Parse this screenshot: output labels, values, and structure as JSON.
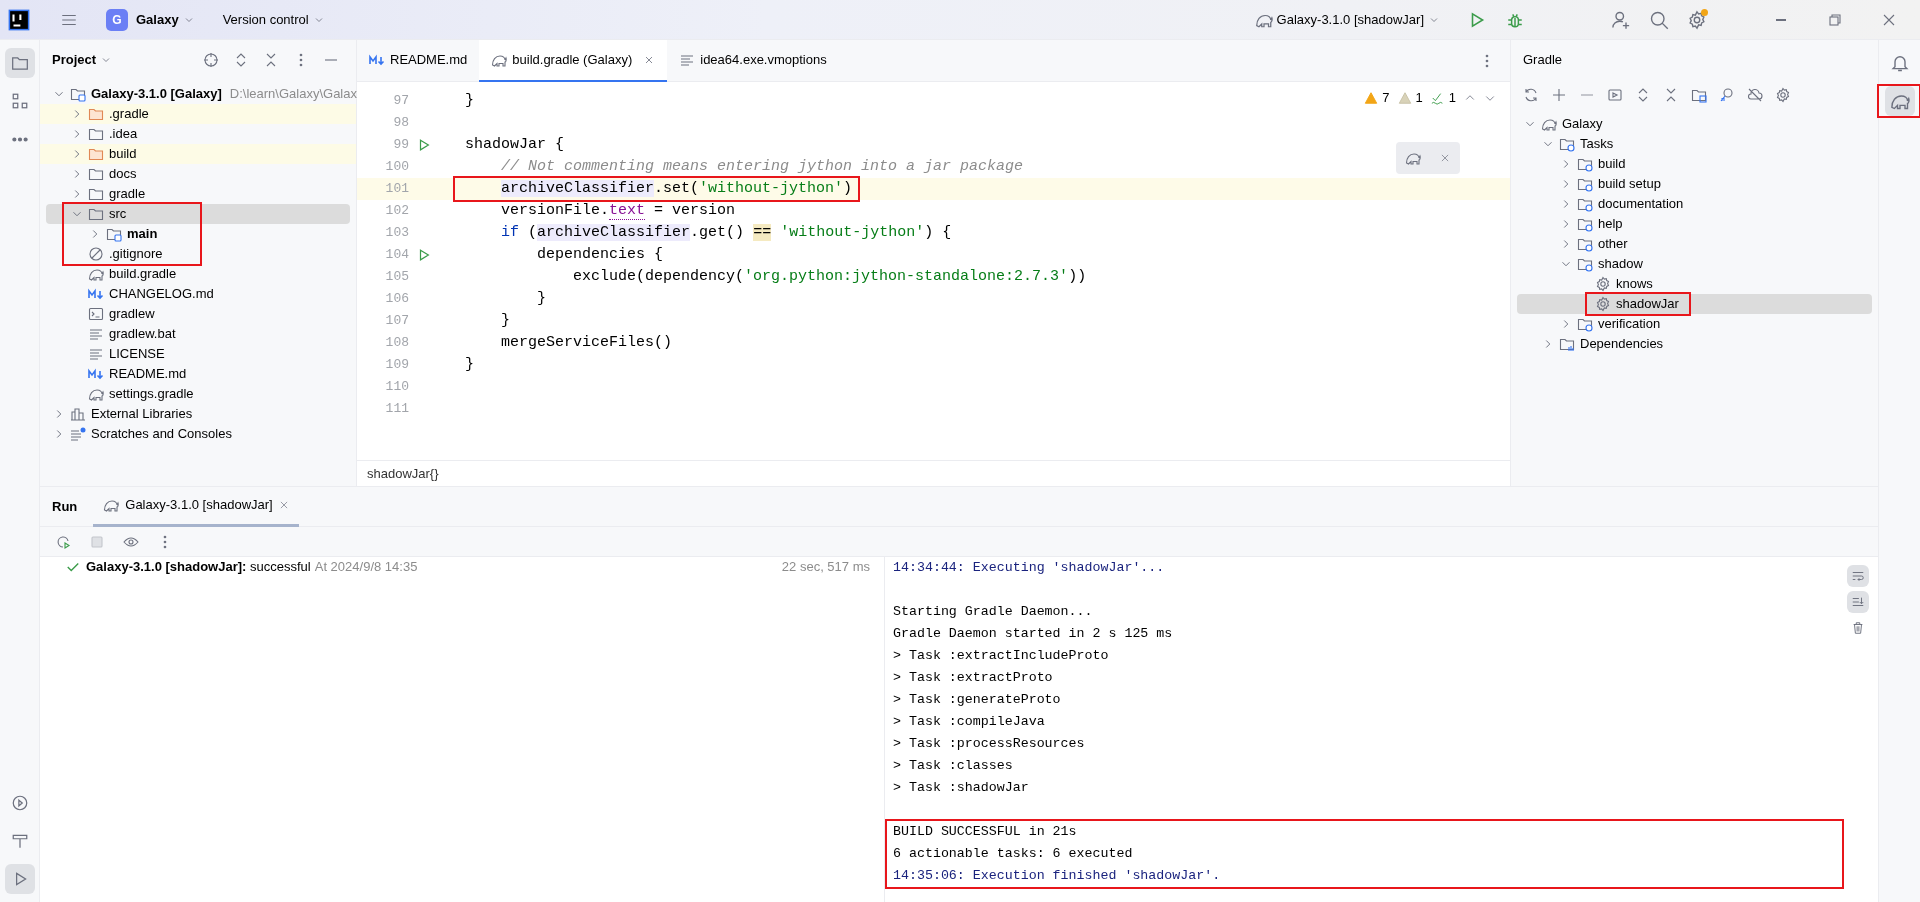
{
  "title_bar": {
    "project_initial": "G",
    "project": "Galaxy",
    "vcs": "Version control",
    "run_config": "Galaxy-3.1.0 [shadowJar]",
    "settings_badge": true
  },
  "left_tools": [
    {
      "kind": "folder",
      "selected": true
    },
    {
      "kind": "structure",
      "selected": false
    },
    {
      "kind": "more",
      "selected": false
    }
  ],
  "left_tools_bottom": [
    {
      "kind": "services",
      "selected": false
    },
    {
      "kind": "build",
      "selected": false
    },
    {
      "kind": "run",
      "selected": true
    }
  ],
  "project_panel": {
    "title": "Project",
    "tree": [
      {
        "label": "Galaxy-3.1.0 [Galaxy]",
        "path": "D:\\learn\\Galaxy\\Galax",
        "kind": "module",
        "expanded": true,
        "selected": false,
        "children": [
          {
            "label": ".gradle",
            "kind": "excluded-folder",
            "expanded": false,
            "selected": false
          },
          {
            "label": ".idea",
            "kind": "folder",
            "expanded": false,
            "selected": false
          },
          {
            "label": "build",
            "kind": "excluded-folder",
            "expanded": false,
            "selected": false
          },
          {
            "label": "docs",
            "kind": "folder",
            "expanded": false,
            "selected": false
          },
          {
            "label": "gradle",
            "kind": "folder",
            "expanded": false,
            "selected": false
          },
          {
            "label": "src",
            "kind": "folder",
            "expanded": true,
            "selected": true,
            "annotated": true,
            "children": [
              {
                "label": "main",
                "kind": "source-root",
                "expanded": false,
                "selected": false,
                "annotated": true
              }
            ]
          },
          {
            "label": ".gitignore",
            "kind": "ignore",
            "selected": false,
            "annotated": true
          },
          {
            "label": "build.gradle",
            "kind": "gradle",
            "selected": false
          },
          {
            "label": "CHANGELOG.md",
            "kind": "markdown",
            "selected": false
          },
          {
            "label": "gradlew",
            "kind": "script",
            "selected": false
          },
          {
            "label": "gradlew.bat",
            "kind": "text",
            "selected": false
          },
          {
            "label": "LICENSE",
            "kind": "text",
            "selected": false
          },
          {
            "label": "README.md",
            "kind": "markdown",
            "selected": false
          },
          {
            "label": "settings.gradle",
            "kind": "gradle",
            "selected": false
          }
        ]
      },
      {
        "label": "External Libraries",
        "kind": "libraries",
        "expanded": false,
        "selected": false
      },
      {
        "label": "Scratches and Consoles",
        "kind": "scratches",
        "expanded": false,
        "selected": false
      }
    ]
  },
  "editor": {
    "tabs": [
      {
        "label": "README.md",
        "kind": "markdown",
        "selected": false
      },
      {
        "label": "build.gradle (Galaxy)",
        "kind": "gradle",
        "selected": true
      },
      {
        "label": "idea64.exe.vmoptions",
        "kind": "text",
        "selected": false
      }
    ],
    "inspections": [
      {
        "kind": "warning",
        "count": "7"
      },
      {
        "kind": "weak-warning",
        "count": "1"
      },
      {
        "kind": "typo",
        "count": "1"
      }
    ],
    "lines": [
      {
        "number": "97",
        "tokens": [
          {
            "kind": "plain",
            "text": "}"
          }
        ]
      },
      {
        "number": "98"
      },
      {
        "number": "99",
        "runnable": true,
        "tokens": [
          {
            "kind": "plain",
            "text": "shadowJar {"
          }
        ]
      },
      {
        "number": "100",
        "tokens": [
          {
            "kind": "comment",
            "text": "    // Not commenting means entering jython into a jar package"
          }
        ]
      },
      {
        "number": "101",
        "current": true,
        "annotated": true,
        "tokens": [
          {
            "kind": "reference",
            "text": "    archiveClassifier"
          },
          {
            "kind": "plain",
            "text": ".set("
          },
          {
            "kind": "string",
            "text": "'without-jython'"
          },
          {
            "kind": "plain",
            "text": ")"
          }
        ]
      },
      {
        "number": "102",
        "tokens": [
          {
            "kind": "plain",
            "text": "    versionFile."
          },
          {
            "kind": "field",
            "text": "text"
          },
          {
            "kind": "plain",
            "text": " = version"
          }
        ]
      },
      {
        "number": "103",
        "tokens": [
          {
            "kind": "keyword",
            "text": "    if"
          },
          {
            "kind": "plain",
            "text": " ("
          },
          {
            "kind": "reference",
            "text": "archiveClassifier"
          },
          {
            "kind": "plain",
            "text": ".get() "
          },
          {
            "kind": "operator",
            "text": "== "
          },
          {
            "kind": "string",
            "text": "'without-jython'"
          },
          {
            "kind": "plain",
            "text": ") {"
          }
        ]
      },
      {
        "number": "104",
        "runnable": true,
        "tokens": [
          {
            "kind": "plain",
            "text": "        dependencies {"
          }
        ]
      },
      {
        "number": "105",
        "tokens": [
          {
            "kind": "plain",
            "text": "            exclude(dependency("
          },
          {
            "kind": "string",
            "text": "'org.python:jython-standalone:2.7.3'"
          },
          {
            "kind": "plain",
            "text": "))"
          }
        ]
      },
      {
        "number": "106",
        "tokens": [
          {
            "kind": "plain",
            "text": "        }"
          }
        ]
      },
      {
        "number": "107",
        "tokens": [
          {
            "kind": "plain",
            "text": "    }"
          }
        ]
      },
      {
        "number": "108",
        "tokens": [
          {
            "kind": "plain",
            "text": "    mergeServiceFiles()"
          }
        ]
      },
      {
        "number": "109",
        "tokens": [
          {
            "kind": "plain",
            "text": "}"
          }
        ]
      },
      {
        "number": "110"
      },
      {
        "number": "111"
      }
    ],
    "breadcrumb": "shadowJar{}"
  },
  "gradle_panel": {
    "title": "Gradle",
    "tree": [
      {
        "label": "Galaxy",
        "kind": "project",
        "expanded": true,
        "selected": false,
        "children": [
          {
            "label": "Tasks",
            "kind": "task-folder",
            "expanded": true,
            "selected": false,
            "children": [
              {
                "label": "build",
                "kind": "task-folder",
                "expanded": false,
                "selected": false
              },
              {
                "label": "build setup",
                "kind": "task-folder",
                "expanded": false,
                "selected": false
              },
              {
                "label": "documentation",
                "kind": "task-folder",
                "expanded": false,
                "selected": false
              },
              {
                "label": "help",
                "kind": "task-folder",
                "expanded": false,
                "selected": false
              },
              {
                "label": "other",
                "kind": "task-folder",
                "expanded": false,
                "selected": false
              },
              {
                "label": "shadow",
                "kind": "task-folder",
                "expanded": true,
                "selected": false,
                "children": [
                  {
                    "label": "knows",
                    "kind": "task",
                    "selected": false
                  },
                  {
                    "label": "shadowJar",
                    "kind": "task",
                    "selected": true,
                    "annotated": true
                  }
                ]
              },
              {
                "label": "verification",
                "kind": "task-folder",
                "expanded": false,
                "selected": false
              }
            ]
          },
          {
            "label": "Dependencies",
            "kind": "dependencies",
            "expanded": false,
            "selected": false
          }
        ]
      }
    ]
  },
  "right_tools": [
    {
      "kind": "bell",
      "selected": false
    },
    {
      "kind": "gradle",
      "selected": true,
      "annotated": true
    }
  ],
  "run_panel": {
    "title": "Run",
    "tab": {
      "label": "Galaxy-3.1.0 [shadowJar]",
      "selected": true
    },
    "result": {
      "summary": "**Galaxy-3.1.0 [shadowJar]:** successful",
      "time": "At 2024/9/8 14:35",
      "duration": "22 sec, 517 ms"
    },
    "console": [
      {
        "kind": "info",
        "text": "14:34:44: Executing 'shadowJar'..."
      },
      {
        "kind": "blank"
      },
      {
        "kind": "plain",
        "text": "Starting Gradle Daemon..."
      },
      {
        "kind": "plain",
        "text": "Gradle Daemon started in 2 s 125 ms"
      },
      {
        "kind": "plain",
        "text": "> Task :extractIncludeProto"
      },
      {
        "kind": "plain",
        "text": "> Task :extractProto"
      },
      {
        "kind": "plain",
        "text": "> Task :generateProto"
      },
      {
        "kind": "plain",
        "text": "> Task :compileJava"
      },
      {
        "kind": "plain",
        "text": "> Task :processResources"
      },
      {
        "kind": "plain",
        "text": "> Task :classes"
      },
      {
        "kind": "plain",
        "text": "> Task :shadowJar"
      },
      {
        "kind": "blank"
      },
      {
        "kind": "plain",
        "text": "BUILD SUCCESSFUL in 21s",
        "annotated": true
      },
      {
        "kind": "plain",
        "text": "6 actionable tasks: 6 executed",
        "annotated": true
      },
      {
        "kind": "info",
        "text": "14:35:06: Execution finished 'shadowJar'.",
        "annotated": true
      }
    ]
  }
}
